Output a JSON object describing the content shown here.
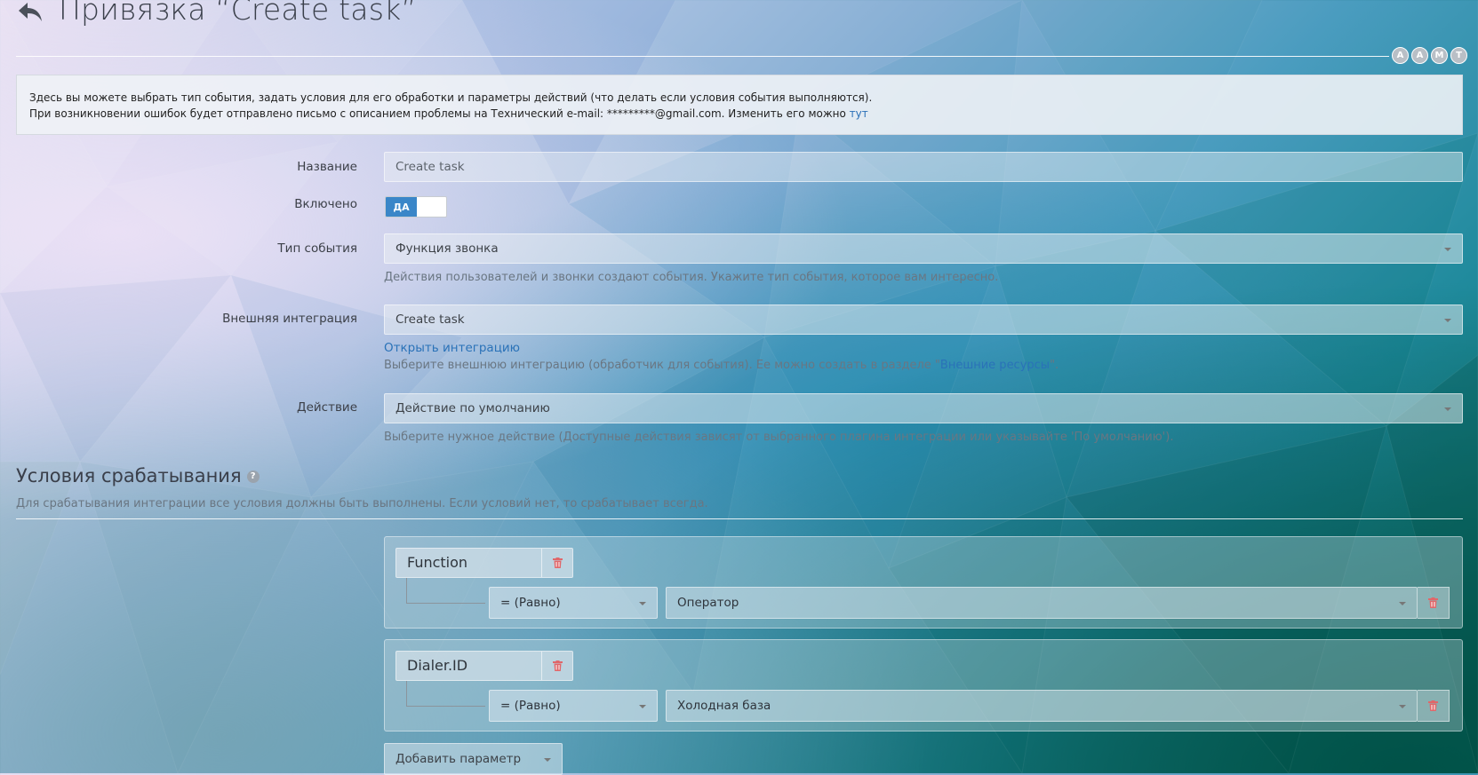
{
  "header": {
    "title": "Привязка “Create task”",
    "back_icon": "reply-arrow-icon",
    "avatars": [
      "A",
      "A",
      "M",
      "T"
    ]
  },
  "info": {
    "line1": "Здесь вы можете выбрать тип события, задать условия для его обработки и параметры действий (что делать если условия события выполняются).",
    "line2": "При возникновении ошибок будет отправлено письмо с описанием проблемы на Технический e-mail: *********@gmail.com. Изменить его можно",
    "link": "тут"
  },
  "form": {
    "name_label": "Название",
    "name_placeholder": "Create task",
    "enabled_label": "Включено",
    "enabled_value": "ДА",
    "event_type_label": "Тип события",
    "event_type_value": "Функция звонка",
    "event_type_help": "Действия пользователей и звонки создают события. Укажите тип события, которое вам интересно.",
    "integration_label": "Внешняя интеграция",
    "integration_value": "Create task",
    "integration_link": "Открыть интеграцию",
    "integration_help_prefix": "Выберите внешнюю интеграцию (обработчик для события). Ее можно создать в разделе \"",
    "integration_help_link": "Внешние ресурсы",
    "integration_help_suffix": "\".",
    "action_label": "Действие",
    "action_value": "Действие по умолчанию",
    "action_help": "Выберите нужное действие (Доступные действия зависят от выбранного плагина интеграции или указывайте 'По умолчанию')."
  },
  "conditions": {
    "title": "Условия срабатывания",
    "description": "Для срабатывания интеграции все условия должны быть выполнены. Если условий нет, то срабатывает всегда.",
    "items": [
      {
        "param": "Function",
        "operator": "= (Равно)",
        "value": "Оператор"
      },
      {
        "param": "Dialer.ID",
        "operator": "= (Равно)",
        "value": "Холодная база"
      }
    ],
    "add_button": "Добавить параметр"
  },
  "colors": {
    "accent": "#3a86c8",
    "link": "#2a72b8",
    "delete": "#e0676a"
  }
}
